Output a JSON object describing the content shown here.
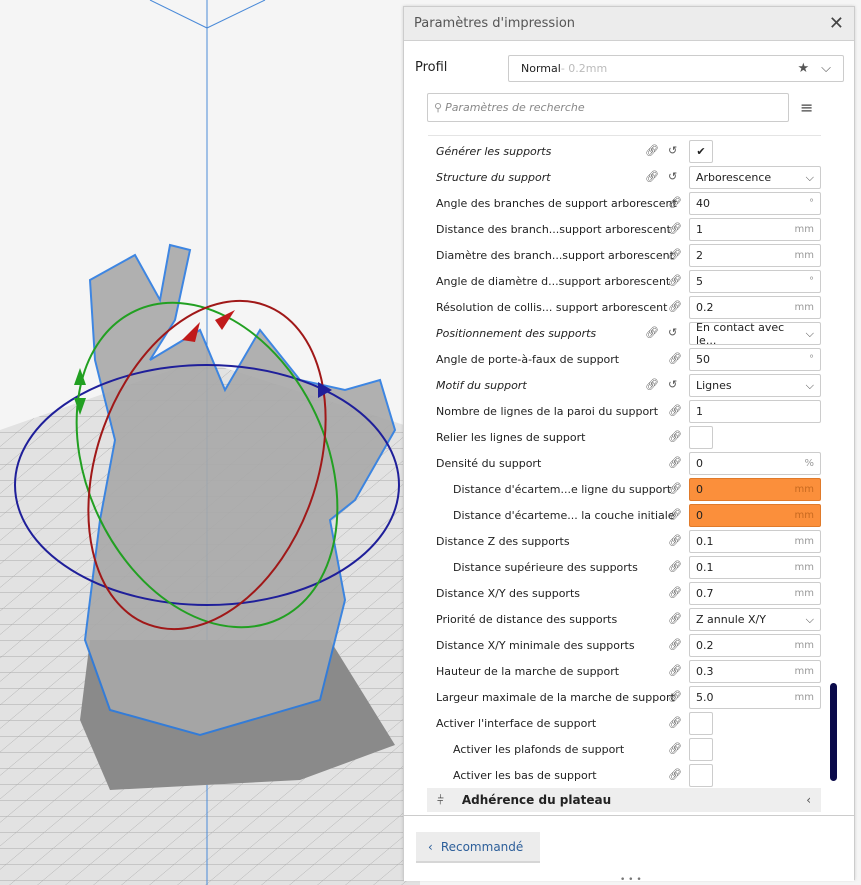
{
  "panel": {
    "title": "Paramètres d'impression",
    "close_icon": "close-icon"
  },
  "profile": {
    "label": "Profil",
    "value": "Normal",
    "sub": " - 0.2mm"
  },
  "search": {
    "placeholder": "Paramètres de recherche"
  },
  "rows": [
    {
      "label": "Générer les supports",
      "italic": true,
      "reset": true,
      "type": "check",
      "checked": true
    },
    {
      "label": "Structure du support",
      "italic": true,
      "reset": true,
      "type": "select",
      "value": "Arborescence"
    },
    {
      "label": "Angle des branches de support arborescent",
      "type": "input",
      "value": "40",
      "unit": "°"
    },
    {
      "label": "Distance des branch...support arborescent",
      "type": "input",
      "value": "1",
      "unit": "mm"
    },
    {
      "label": "Diamètre des branch...support arborescent",
      "type": "input",
      "value": "2",
      "unit": "mm"
    },
    {
      "label": "Angle de diamètre d...support arborescent",
      "type": "input",
      "value": "5",
      "unit": "°"
    },
    {
      "label": "Résolution de collis... support arborescent",
      "type": "input",
      "value": "0.2",
      "unit": "mm"
    },
    {
      "label": "Positionnement des supports",
      "italic": true,
      "reset": true,
      "type": "select",
      "value": "En contact avec le..."
    },
    {
      "label": "Angle de porte-à-faux de support",
      "type": "input",
      "value": "50",
      "unit": "°"
    },
    {
      "label": "Motif du support",
      "italic": true,
      "reset": true,
      "type": "select",
      "value": "Lignes"
    },
    {
      "label": "Nombre de lignes de la paroi du support",
      "type": "input",
      "value": "1",
      "unit": ""
    },
    {
      "label": "Relier les lignes de support",
      "type": "check",
      "checked": false
    },
    {
      "label": "Densité du support",
      "type": "input",
      "value": "0",
      "unit": "%"
    },
    {
      "label": "Distance d'écartem...e ligne du support",
      "indent": true,
      "type": "input",
      "value": "0",
      "unit": "mm",
      "warn": true
    },
    {
      "label": "Distance d'écarteme... la couche initiale",
      "indent": true,
      "type": "input",
      "value": "0",
      "unit": "mm",
      "warn": true
    },
    {
      "label": "Distance Z des supports",
      "type": "input",
      "value": "0.1",
      "unit": "mm"
    },
    {
      "label": "Distance supérieure des supports",
      "indent": true,
      "type": "input",
      "value": "0.1",
      "unit": "mm"
    },
    {
      "label": "Distance X/Y des supports",
      "type": "input",
      "value": "0.7",
      "unit": "mm"
    },
    {
      "label": "Priorité de distance des supports",
      "type": "select",
      "value": "Z annule X/Y"
    },
    {
      "label": "Distance X/Y minimale des supports",
      "type": "input",
      "value": "0.2",
      "unit": "mm"
    },
    {
      "label": "Hauteur de la marche de support",
      "type": "input",
      "value": "0.3",
      "unit": "mm"
    },
    {
      "label": "Largeur maximale de la marche de support",
      "type": "input",
      "value": "5.0",
      "unit": "mm"
    },
    {
      "label": "Activer l'interface de support",
      "type": "check",
      "checked": false
    },
    {
      "label": "Activer les plafonds de support",
      "indent": true,
      "type": "check",
      "checked": false
    },
    {
      "label": "Activer les bas de support",
      "indent": true,
      "type": "check",
      "checked": false
    }
  ],
  "section": {
    "label": "Adhérence du plateau"
  },
  "footer": {
    "recommended": "Recommandé"
  },
  "colors": {
    "warn": "#fb8f3b",
    "link": "#2d5f9a"
  }
}
